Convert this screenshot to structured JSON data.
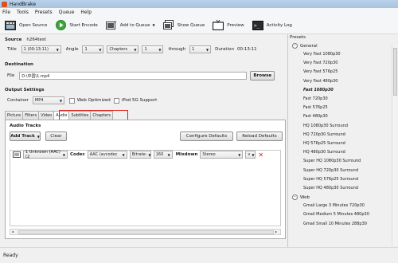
{
  "window": {
    "title": "HandBrake"
  },
  "menu": [
    "File",
    "Tools",
    "Presets",
    "Queue",
    "Help"
  ],
  "toolbar": {
    "open_source": "Open Source",
    "start_encode": "Start Encode",
    "add_to_queue": "Add to Queue",
    "show_queue": "Show Queue",
    "preview": "Preview",
    "activity_log": "Activity Log"
  },
  "source": {
    "label": "Source",
    "name": "h264test",
    "title_label": "Title",
    "title_value": "1 (00:13:11)",
    "angle_label": "Angle",
    "angle_value": "1",
    "range_type": "Chapters",
    "range_start": "1",
    "through_label": "through",
    "range_end": "1",
    "duration_label": "Duration",
    "duration_value": "00:13:11"
  },
  "destination": {
    "label": "Destination",
    "file_label": "File",
    "file_value": "D:\\中国\\1.mp4",
    "browse": "Browse"
  },
  "output": {
    "label": "Output Settings",
    "container_label": "Container",
    "container_value": "MP4",
    "web_optimized": "Web Optimized",
    "ipod": "iPod 5G Support"
  },
  "tabs": [
    "Picture",
    "Filters",
    "Video",
    "Audio",
    "Subtitles",
    "Chapters"
  ],
  "audio": {
    "heading": "Audio Tracks",
    "add_track": "Add Track",
    "clear": "Clear",
    "configure_defaults": "Configure Defaults",
    "reload_defaults": "Reload Defaults",
    "track": {
      "source": "1 Unknown (AAC) (2",
      "codec_label": "Codec",
      "codec_value": "AAC (avcodec",
      "bitrate_value": "Bitrate:",
      "bitrate_num": "160",
      "mixdown_label": "Mixdown",
      "mixdown_value": "Stereo",
      "extra": "v"
    }
  },
  "presets": {
    "heading": "Presets",
    "groups": [
      {
        "name": "General",
        "items": [
          "Very Fast 1080p30",
          "Very Fast 720p30",
          "Very Fast 576p25",
          "Very Fast 480p30",
          "Fast 1080p30",
          "Fast 720p30",
          "Fast 576p25",
          "Fast 480p30",
          "HQ 1080p30 Surround",
          "HQ 720p30 Surround",
          "HQ 576p25 Surround",
          "HQ 480p30 Surround",
          "Super HQ 1080p30 Surround",
          "Super HQ 720p30 Surround",
          "Super HQ 576p25 Surround",
          "Super HQ 480p30 Surround"
        ]
      },
      {
        "name": "Web",
        "items": [
          "Gmail Large 3 Minutes 720p30",
          "Gmail Medium 5 Minutes 480p30",
          "Gmail Small 10 Minutes 288p30"
        ]
      }
    ],
    "selected": "Fast 1080p30"
  },
  "status": "Ready",
  "colors": {
    "highlight": "#e0201a",
    "titlebar": "#b9d1ea"
  }
}
